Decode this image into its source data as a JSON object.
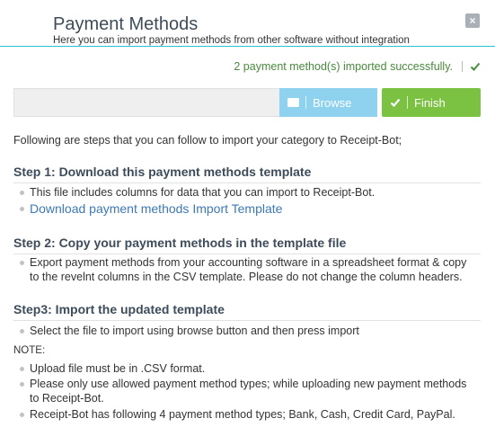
{
  "modal": {
    "title": "Payment Methods",
    "subtitle": "Here you can import payment methods from other software without integration",
    "close_label": "×"
  },
  "status": {
    "message": "2 payment method(s) imported successfully.",
    "color": "#4a8a3c"
  },
  "upload": {
    "file_value": "",
    "browse_label": "Browse",
    "finish_label": "Finish"
  },
  "intro": "Following are steps that you can follow to import your category to Receipt-Bot;",
  "steps": [
    {
      "heading": "Step 1: Download this payment methods template",
      "items": [
        "This file includes columns for data that you can import to Receipt-Bot."
      ],
      "link": "Download payment methods Import Template"
    },
    {
      "heading": "Step 2: Copy your payment methods in the template file",
      "items": [
        "Export payment methods from your accounting software in a spreadsheet format & copy to the revelnt columns in the CSV template. Please do not change the column headers."
      ]
    },
    {
      "heading": "Step3: Import the updated template",
      "items": [
        "Select the file to import using browse button and then press import"
      ]
    }
  ],
  "note": {
    "label": "NOTE:",
    "items": [
      "Upload file must be in .CSV format.",
      "Please only use allowed payment method types; while uploading new payment methods to Receipt-Bot.",
      "Receipt-Bot has following 4 payment method types; Bank, Cash, Credit Card, PayPal."
    ]
  },
  "colors": {
    "accent": "#2bbfd1",
    "browse": "#8ed2f0",
    "finish": "#7cc242",
    "link": "#3c79b6"
  }
}
